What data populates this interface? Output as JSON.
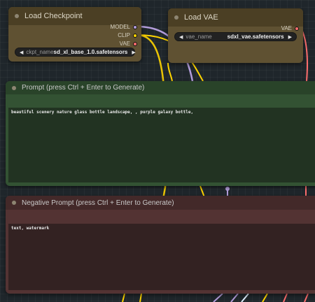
{
  "checkpoint_node": {
    "title": "Load Checkpoint",
    "outputs": [
      "MODEL",
      "CLIP",
      "VAE"
    ],
    "widget": {
      "label": "ckpt_name",
      "value": "sd_xl_base_1.0.safetensors"
    }
  },
  "vae_node": {
    "title": "Load VAE",
    "outputs": [
      "VAE"
    ],
    "widget": {
      "label": "vae_name",
      "value": "sdxl_vae.safetensors"
    }
  },
  "positive_node": {
    "title": "Prompt (press Ctrl + Enter to Generate)",
    "text": "beautiful scenery nature glass bottle landscape, , purple galaxy bottle,"
  },
  "negative_node": {
    "title": "Negative Prompt (press Ctrl + Enter to Generate)",
    "text": "text, watermark"
  },
  "colors": {
    "model": "#b39ddb",
    "clip": "#ffd500",
    "vae": "#ff6e6e",
    "canvas": "#1f262b"
  }
}
